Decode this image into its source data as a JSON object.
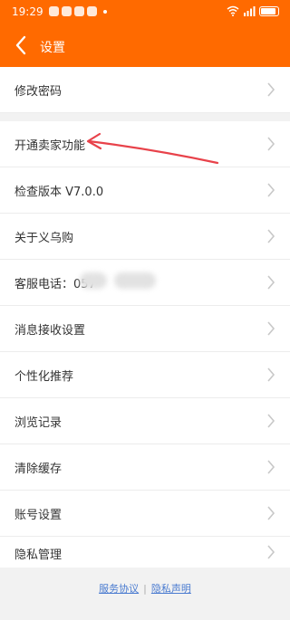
{
  "status_bar": {
    "time": "19:29",
    "battery_icon": "battery-icon",
    "wifi_icon": "wifi-icon",
    "signal_icon": "signal-icon"
  },
  "header": {
    "title": "设置",
    "back_icon": "back-chevron-icon",
    "background_color": "#ff6a00"
  },
  "settings": {
    "items": [
      {
        "label": "修改密码"
      },
      {
        "label": "开通卖家功能"
      },
      {
        "label": "检查版本 V7.0.0"
      },
      {
        "label": "关于义乌购"
      },
      {
        "label": "客服电话：057"
      },
      {
        "label": "消息接收设置"
      },
      {
        "label": "个性化推荐"
      },
      {
        "label": "浏览记录"
      },
      {
        "label": "清除缓存"
      },
      {
        "label": "账号设置"
      },
      {
        "label": "隐私管理"
      }
    ]
  },
  "footer": {
    "service_agreement": "服务协议",
    "separator": "|",
    "privacy_statement": "隐私声明",
    "link_color": "#4a7bd0"
  },
  "annotation": {
    "arrow_color": "#e8424a"
  }
}
